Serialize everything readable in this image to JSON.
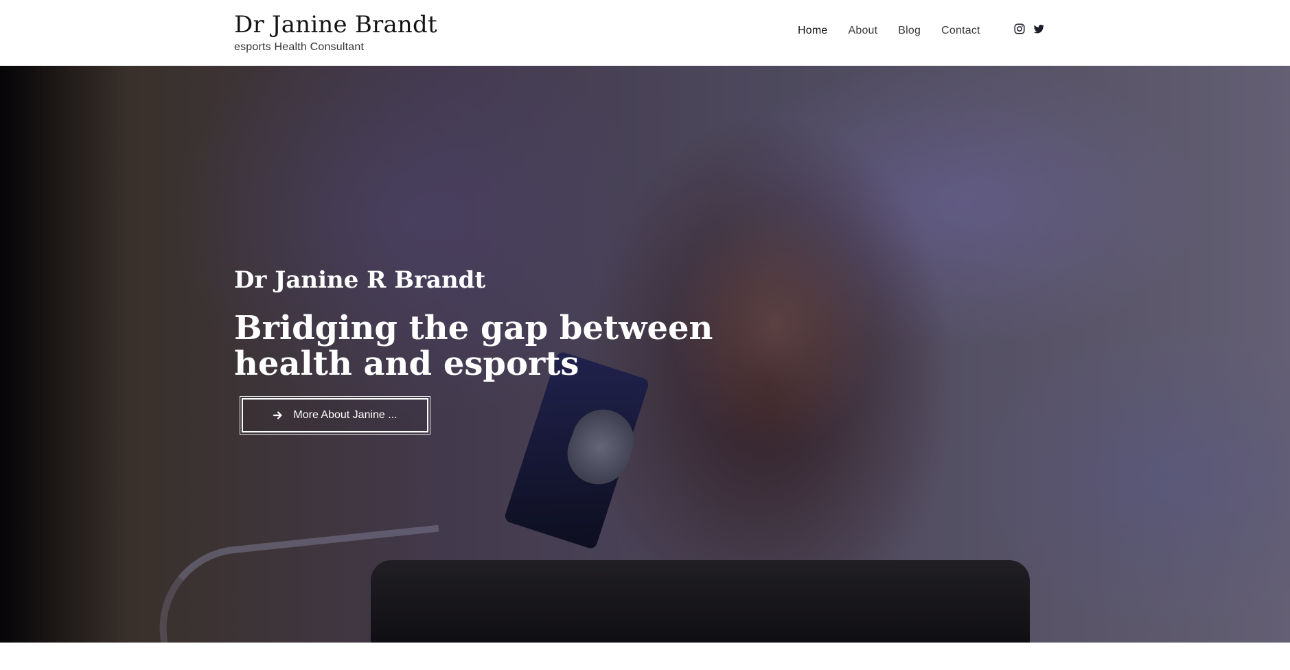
{
  "header": {
    "title": "Dr Janine Brandt",
    "subtitle": "esports Health Consultant",
    "nav": [
      {
        "label": "Home"
      },
      {
        "label": "About"
      },
      {
        "label": "Blog"
      },
      {
        "label": "Contact"
      }
    ],
    "socials": [
      {
        "icon": "instagram-icon"
      },
      {
        "icon": "twitter-icon"
      }
    ]
  },
  "hero": {
    "name": "Dr Janine R Brandt",
    "heading": "Bridging the gap between health and esports",
    "button_label": "More About Janine ...",
    "button_icon": "arrow-right-icon"
  },
  "colors": {
    "header_bg": "#ffffff",
    "text_dark": "#141414",
    "hero_text": "#ffffff"
  }
}
